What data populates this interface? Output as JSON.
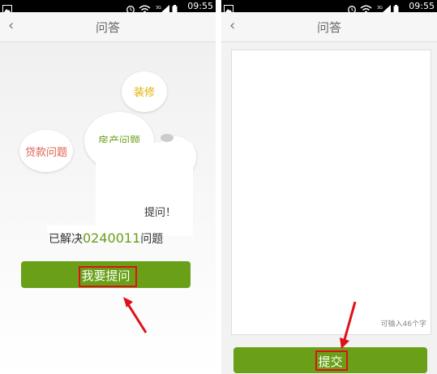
{
  "status_bar": {
    "time": "09:55"
  },
  "left_screen": {
    "title": "问答",
    "bubbles": {
      "decor": "装修",
      "house": "房产问题",
      "loan": "贷款问题"
    },
    "ask_line": "提问！",
    "solved_prefix": "已解决",
    "solved_count": "0240011",
    "solved_suffix": "问题",
    "ask_button": "我要提问"
  },
  "right_screen": {
    "title": "问答",
    "char_hint": "可输入46个字",
    "submit_button": "提交"
  },
  "colors": {
    "green": "#6aa018",
    "annotation_red": "#e0101a"
  }
}
